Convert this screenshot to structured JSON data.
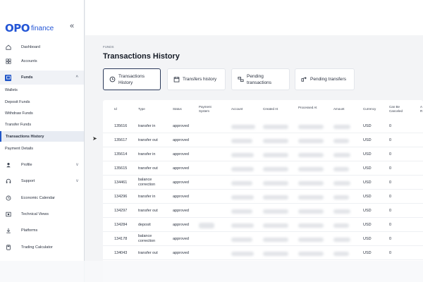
{
  "brand": {
    "mark": "OPO",
    "name": "finance"
  },
  "sidebar": {
    "collapse_icon": "«",
    "items": [
      {
        "label": "Dashboard",
        "icon": "home-icon"
      },
      {
        "label": "Accounts",
        "icon": "grid-icon"
      },
      {
        "label": "Funds",
        "icon": "wallet-icon",
        "chevron": "^"
      },
      {
        "label": "Profile",
        "icon": "user-icon",
        "chevron": "v"
      },
      {
        "label": "Support",
        "icon": "headset-icon",
        "chevron": "v"
      },
      {
        "label": "Economic Calendar",
        "icon": "clock-icon"
      },
      {
        "label": "Technical Views",
        "icon": "chart-icon"
      },
      {
        "label": "Platforms",
        "icon": "download-icon"
      },
      {
        "label": "Trading Calculator",
        "icon": "calculator-icon"
      }
    ],
    "sub_items": [
      {
        "label": "Wallets"
      },
      {
        "label": "Deposit Funds"
      },
      {
        "label": "Withdraw Funds"
      },
      {
        "label": "Transfer Funds"
      },
      {
        "label": "Transactions History"
      },
      {
        "label": "Payment Details"
      }
    ]
  },
  "main": {
    "breadcrumb": "FUNDS",
    "title": "Transactions History",
    "tabs": [
      {
        "line1": "Transactions",
        "line2": "History",
        "icon": "history-icon"
      },
      {
        "line1": "Transfers history",
        "line2": "",
        "icon": "calendar-icon"
      },
      {
        "line1": "Pending",
        "line2": "transactions",
        "icon": "pending-icon"
      },
      {
        "line1": "Pending transfers",
        "line2": "",
        "icon": "transfer-icon"
      }
    ]
  },
  "table": {
    "headers": [
      {
        "l1": "Id",
        "l2": ""
      },
      {
        "l1": "Type",
        "l2": ""
      },
      {
        "l1": "Status",
        "l2": ""
      },
      {
        "l1": "Payment",
        "l2": "System"
      },
      {
        "l1": "Account",
        "l2": ""
      },
      {
        "l1": "Created At",
        "l2": ""
      },
      {
        "l1": "Processed At",
        "l2": ""
      },
      {
        "l1": "Amount",
        "l2": ""
      },
      {
        "l1": "Currency",
        "l2": ""
      },
      {
        "l1": "Can Be",
        "l2": "Canceled"
      },
      {
        "l1": "A",
        "l2": "R"
      }
    ],
    "rows": [
      {
        "id": "135616",
        "type1": "transfer in",
        "type2": "",
        "status": "approved",
        "currency": "USD",
        "canceled": "0"
      },
      {
        "id": "135617",
        "type1": "transfer out",
        "type2": "",
        "status": "approved",
        "currency": "USD",
        "canceled": "0"
      },
      {
        "id": "135614",
        "type1": "transfer in",
        "type2": "",
        "status": "approved",
        "currency": "USD",
        "canceled": "0"
      },
      {
        "id": "135615",
        "type1": "transfer out",
        "type2": "",
        "status": "approved",
        "currency": "USD",
        "canceled": "0"
      },
      {
        "id": "134461",
        "type1": "balance",
        "type2": "correction",
        "status": "approved",
        "currency": "USD",
        "canceled": "0"
      },
      {
        "id": "134296",
        "type1": "transfer in",
        "type2": "",
        "status": "approved",
        "currency": "USD",
        "canceled": "0"
      },
      {
        "id": "134297",
        "type1": "transfer out",
        "type2": "",
        "status": "approved",
        "currency": "USD",
        "canceled": "0"
      },
      {
        "id": "134284",
        "type1": "deposit",
        "type2": "",
        "status": "approved",
        "currency": "USD",
        "canceled": "0"
      },
      {
        "id": "134178",
        "type1": "balance",
        "type2": "correction",
        "status": "approved",
        "currency": "USD",
        "canceled": "0"
      },
      {
        "id": "134043",
        "type1": "transfer out",
        "type2": "",
        "status": "approved",
        "currency": "USD",
        "canceled": "0"
      }
    ]
  },
  "colors": {
    "brand": "#2456d6",
    "accent": "#1f55c7",
    "active_tab_border": "#2b3a5a"
  }
}
